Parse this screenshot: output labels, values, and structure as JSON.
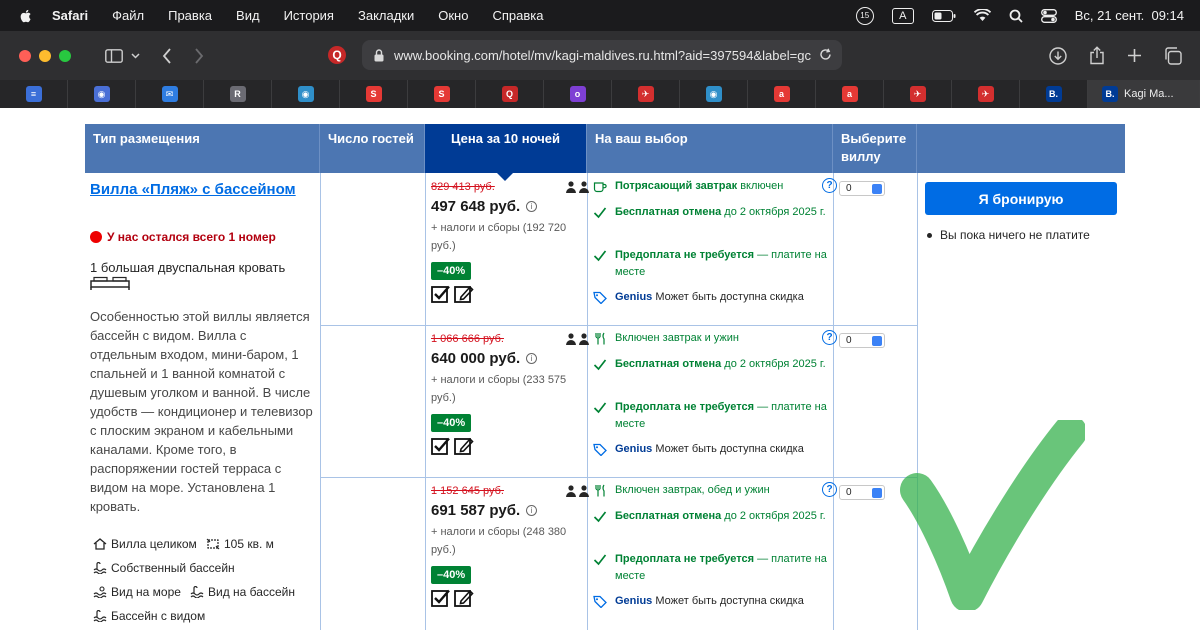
{
  "menubar": {
    "app": "Safari",
    "items": [
      "Файл",
      "Правка",
      "Вид",
      "История",
      "Закладки",
      "Окно",
      "Справка"
    ],
    "notification_count": "15",
    "input_source": "A",
    "datetime": "Вс, 21 сент.  09:14"
  },
  "toolbar": {
    "url": "www.booking.com/hotel/mv/kagi-maldives.ru.html?aid=397594&label=gc"
  },
  "tabs": {
    "active_label": "Kagi Ma...",
    "favicons": [
      {
        "glyph": "≡",
        "color": "#3b6fd8"
      },
      {
        "glyph": "◉",
        "color": "#4a6fd6"
      },
      {
        "glyph": "✉",
        "color": "#2f7de1"
      },
      {
        "glyph": "R",
        "color": "#6b6b73"
      },
      {
        "glyph": "◉",
        "color": "#2f8fc9"
      },
      {
        "glyph": "S",
        "color": "#e53935"
      },
      {
        "glyph": "S",
        "color": "#e53935"
      },
      {
        "glyph": "Q",
        "color": "#c62828"
      },
      {
        "glyph": "o",
        "color": "#7e3fd4"
      },
      {
        "glyph": "✈",
        "color": "#d32f2f"
      },
      {
        "glyph": "◉",
        "color": "#2f8fc9"
      },
      {
        "glyph": "a",
        "color": "#e53935"
      },
      {
        "glyph": "a",
        "color": "#e53935"
      },
      {
        "glyph": "✈",
        "color": "#d32f2f"
      },
      {
        "glyph": "✈",
        "color": "#d32f2f"
      },
      {
        "glyph": "B.",
        "color": "#003b95"
      }
    ],
    "active_glyph": "B."
  },
  "table": {
    "headers": {
      "type": "Тип размещения",
      "guests": "Число гостей",
      "price": "Цена за 10 ночей",
      "choice": "На ваш выбор",
      "select": "Выберите виллу"
    },
    "villa": {
      "title": "Вилла «Пляж» с бассейном",
      "scarcity": "У нас остался всего 1 номер",
      "bed": "1 большая двуспальная кровать",
      "description": "Особенностью этой виллы является бассейн с видом. Вилла с отдельным входом, мини-баром, 1 спальней и 1 ванной комнатой с душевым уголком и ванной. В числе удобств — кондиционер и телевизор с плоским экраном и кабельными каналами. Кроме того, в распоряжении гостей терраса с видом на море. Установлена 1 кровать.",
      "facilities": [
        "Вилла целиком",
        "105 кв. м",
        "Собственный бассейн",
        "Вид на море",
        "Вид на бассейн",
        "Бассейн с видом"
      ]
    },
    "rows": [
      {
        "old_price": "829 413 руб.",
        "price": "497 648 руб.",
        "tax": "+ налоги и сборы (192 720 руб.)",
        "discount": "–40%",
        "meal_bold": "Потрясающий завтрак",
        "meal_rest": " включен",
        "meal_bold_style": true,
        "select_value": "0"
      },
      {
        "old_price": "1 066 666 руб.",
        "price": "640 000 руб.",
        "tax": "+ налоги и сборы (233 575 руб.)",
        "discount": "–40%",
        "meal_bold": "",
        "meal_rest": "Включен завтрак и ужин",
        "meal_bold_style": false,
        "select_value": "0"
      },
      {
        "old_price": "1 152 645 руб.",
        "price": "691 587 руб.",
        "tax": "+ налоги и сборы (248 380 руб.)",
        "discount": "–40%",
        "meal_bold": "",
        "meal_rest": "Включен завтрак, обед и ужин",
        "meal_bold_style": false,
        "select_value": "0"
      }
    ],
    "cancel_bold": "Бесплатная отмена",
    "cancel_rest": " до 2 октября 2025 г.",
    "prepay_bold": "Предоплата не требуется",
    "prepay_rest": " — платите на месте",
    "genius_word": "Genius",
    "genius_rest": " Может быть доступна скидка",
    "book_button": "Я бронирую",
    "no_pay": "Вы пока ничего не платите"
  },
  "colors": {
    "header": "#4c76b2",
    "price_header": "#003b95",
    "accent": "#006ce4",
    "green": "#008234",
    "strike_red": "#d4111e"
  }
}
